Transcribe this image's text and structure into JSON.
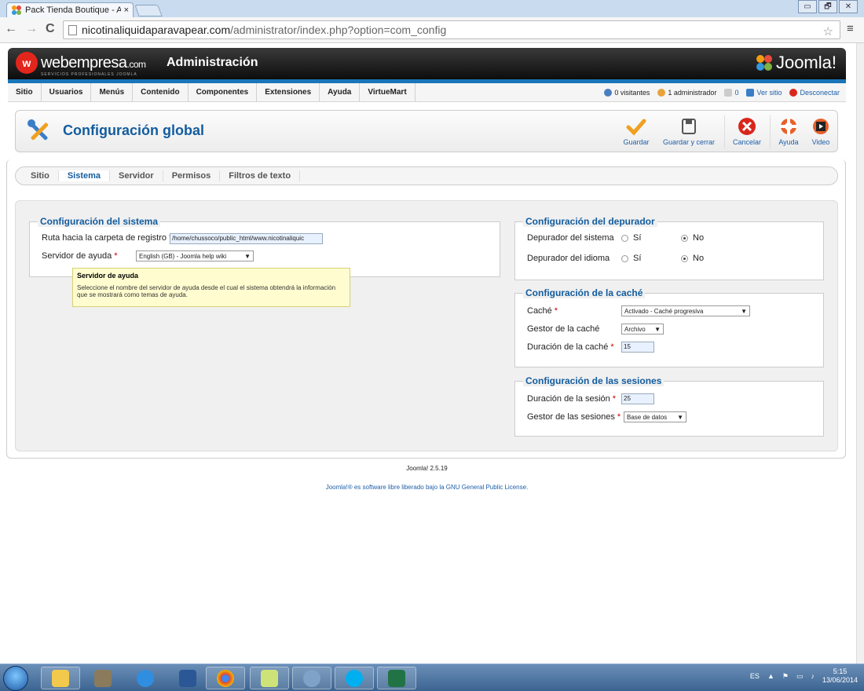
{
  "browser": {
    "tab_title": "Pack Tienda Boutique - A",
    "tab_close": "×",
    "url_host": "nicotinaliquidaparavapear.com",
    "url_path": "/administrator/index.php?option=com_config",
    "back": "←",
    "forward": "→",
    "reload": "C",
    "star": "☆",
    "menu": "≡",
    "window_buttons": [
      "▭",
      "🗗",
      "✕"
    ]
  },
  "header": {
    "brand_name": "webempresa",
    "brand_suffix": ".com",
    "brand_sub": "SERVICIOS PROFESIONALES JOOMLA",
    "admin_title": "Administración",
    "joomla_logo": "Joomla!"
  },
  "topmenu": {
    "items": [
      "Sitio",
      "Usuarios",
      "Menús",
      "Contenido",
      "Componentes",
      "Extensiones",
      "Ayuda",
      "VirtueMart"
    ],
    "visitors": "0 visitantes",
    "admins": "1 administrador",
    "messages": "0",
    "view_site": "Ver sitio",
    "logout": "Desconectar"
  },
  "toolbar": {
    "title": "Configuración global",
    "buttons": {
      "save": "Guardar",
      "save_close": "Guardar y cerrar",
      "cancel": "Cancelar",
      "help": "Ayuda",
      "video": "Video"
    }
  },
  "subtabs": [
    "Sitio",
    "Sistema",
    "Servidor",
    "Permisos",
    "Filtros de texto"
  ],
  "system": {
    "legend": "Configuración del sistema",
    "log_path_label": "Ruta hacia la carpeta de registro",
    "log_path_value": "/home/chussoco/public_html/www.nicotinaliquic",
    "help_server_label": "Servidor de ayuda",
    "help_server_value": "English (GB) - Joomla help wiki"
  },
  "tooltip": {
    "title": "Servidor de ayuda",
    "text": "Seleccione el nombre del servidor de ayuda desde el cual el sistema obtendrá la información que se mostrará como temas de ayuda."
  },
  "debug": {
    "legend": "Configuración del depurador",
    "system_debug_label": "Depurador del sistema",
    "lang_debug_label": "Depurador del idioma",
    "yes": "Sí",
    "no": "No"
  },
  "cache": {
    "legend": "Configuración de la caché",
    "cache_label": "Caché",
    "cache_value": "Activado - Caché progresiva",
    "handler_label": "Gestor de la caché",
    "handler_value": "Archivo",
    "time_label": "Duración de la caché",
    "time_value": "15"
  },
  "session": {
    "legend": "Configuración de las sesiones",
    "lifetime_label": "Duración de la sesión",
    "lifetime_value": "25",
    "handler_label": "Gestor de las sesiones",
    "handler_value": "Base de datos"
  },
  "footer": {
    "version": "Joomla! 2.5.19",
    "license_prefix": "Joomla!® es software libre liberado bajo la",
    "license_link": "GNU General Public License",
    "license_suffix": "."
  },
  "taskbar": {
    "lang": "ES",
    "time": "5:15",
    "date": "13/06/2014"
  }
}
